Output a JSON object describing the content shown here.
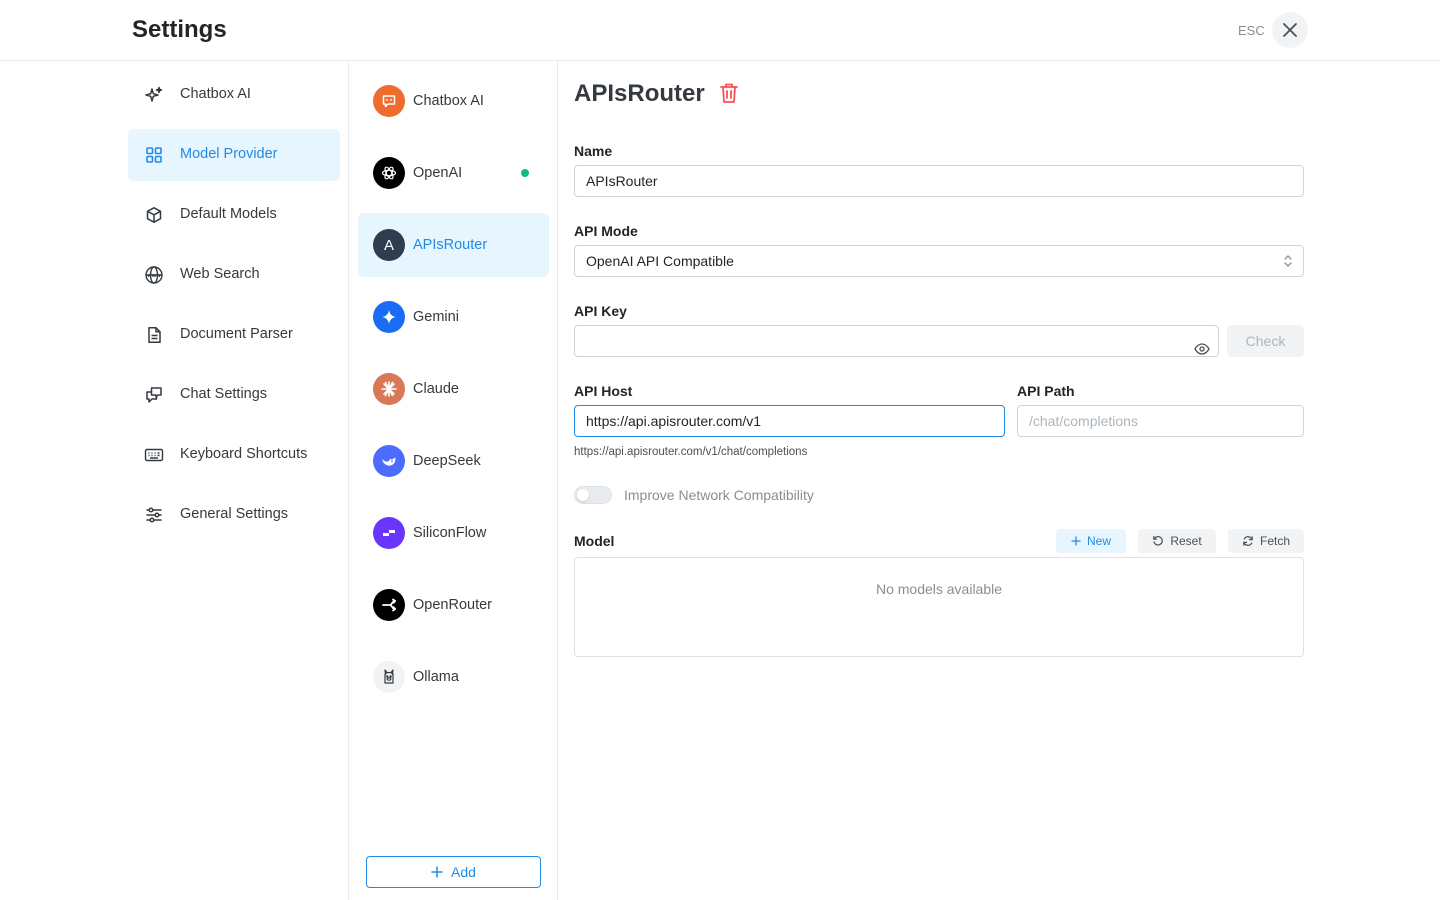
{
  "header": {
    "title": "Settings",
    "esc_label": "ESC"
  },
  "nav": {
    "items": [
      {
        "label": "Chatbox AI",
        "icon": "sparkles-icon"
      },
      {
        "label": "Model Provider",
        "icon": "grid-icon",
        "active": true
      },
      {
        "label": "Default Models",
        "icon": "cube-icon"
      },
      {
        "label": "Web Search",
        "icon": "globe-www-icon"
      },
      {
        "label": "Document Parser",
        "icon": "document-icon"
      },
      {
        "label": "Chat Settings",
        "icon": "chat-bubbles-icon"
      },
      {
        "label": "Keyboard Shortcuts",
        "icon": "keyboard-icon"
      },
      {
        "label": "General Settings",
        "icon": "sliders-icon"
      }
    ]
  },
  "providers": {
    "items": [
      {
        "label": "Chatbox AI",
        "color": "#ef6c2e"
      },
      {
        "label": "OpenAI",
        "color": "#000000",
        "status": "connected"
      },
      {
        "label": "APIsRouter",
        "color": "#2f3e4e",
        "initial": "A",
        "active": true
      },
      {
        "label": "Gemini",
        "color": "#1a6cf5"
      },
      {
        "label": "Claude",
        "color": "#d97757"
      },
      {
        "label": "DeepSeek",
        "color": "#4d6bfe"
      },
      {
        "label": "SiliconFlow",
        "color": "#6a35ff"
      },
      {
        "label": "OpenRouter",
        "color": "#000000"
      },
      {
        "label": "Ollama",
        "color": "#f1f3f5"
      }
    ],
    "add_label": "Add"
  },
  "main": {
    "title": "APIsRouter",
    "name": {
      "label": "Name",
      "value": "APIsRouter"
    },
    "api_mode": {
      "label": "API Mode",
      "value": "OpenAI API Compatible"
    },
    "api_key": {
      "label": "API Key",
      "value": "",
      "check_label": "Check"
    },
    "api_host": {
      "label": "API Host",
      "value": "https://api.apisrouter.com/v1"
    },
    "api_path": {
      "label": "API Path",
      "placeholder": "/chat/completions"
    },
    "endpoint_hint": "https://api.apisrouter.com/v1/chat/completions",
    "compat_toggle": {
      "label": "Improve Network Compatibility",
      "enabled": false
    },
    "model": {
      "label": "Model",
      "new_label": "New",
      "reset_label": "Reset",
      "fetch_label": "Fetch",
      "empty_text": "No models available"
    }
  },
  "colors": {
    "accent": "#228be6",
    "danger": "#fa5252",
    "active_bg": "#e7f5ff"
  }
}
